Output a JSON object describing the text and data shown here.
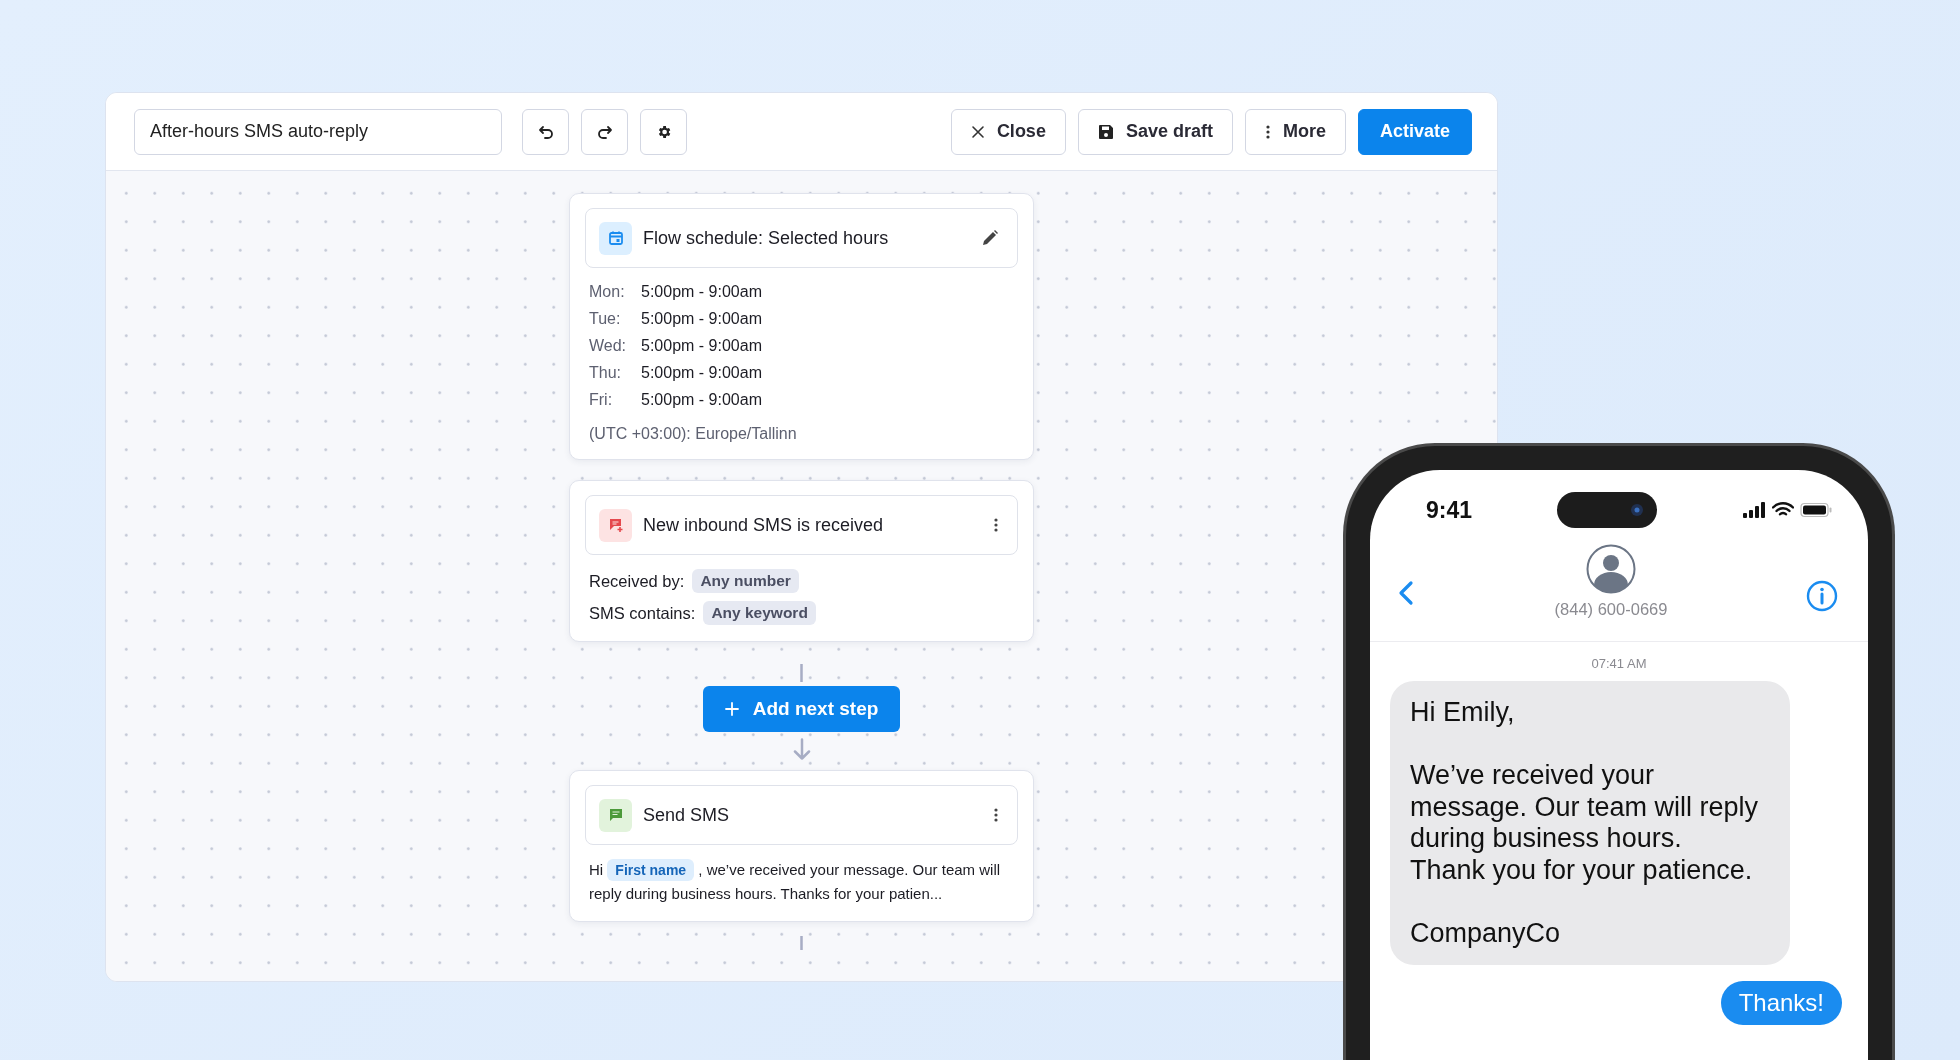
{
  "flow": {
    "title": "After-hours SMS auto-reply",
    "actions": [
      {
        "kind": "close",
        "label": "Close"
      },
      {
        "kind": "save",
        "label": "Save draft"
      },
      {
        "kind": "more",
        "label": "More"
      },
      {
        "kind": "primary",
        "label": "Activate"
      }
    ]
  },
  "steps": [
    {
      "kind": "schedule",
      "title": "Flow schedule: Selected hours",
      "schedule": [
        {
          "day": "Mon:",
          "hours": "5:00pm - 9:00am"
        },
        {
          "day": "Tue:",
          "hours": "5:00pm - 9:00am"
        },
        {
          "day": "Wed:",
          "hours": "5:00pm - 9:00am"
        },
        {
          "day": "Thu:",
          "hours": "5:00pm - 9:00am"
        },
        {
          "day": "Fri:",
          "hours": "5:00pm - 9:00am"
        }
      ],
      "timezone": "(UTC +03:00): Europe/Tallinn"
    },
    {
      "kind": "trigger",
      "title": "New inbound SMS is received",
      "conditions": [
        {
          "label": "Received by:",
          "value": "Any number"
        },
        {
          "label": "SMS contains:",
          "value": "Any keyword"
        }
      ]
    },
    {
      "kind": "action",
      "title": "Send SMS",
      "message_before": "Hi",
      "variable": "First name",
      "message_after": ", we’ve received your message. Our team will reply during business hours. Thanks for your patien..."
    }
  ],
  "add_step": {
    "label": "Add next step"
  },
  "phone": {
    "time": "9:41",
    "contact": "(844) 600-0669",
    "timestamp": "07:41 AM",
    "messages": [
      {
        "kind": "received",
        "text": "Hi Emily,\n\nWe’ve received your message. Our team will reply during business hours.\nThank you for your patience.\n\nCompanyCo"
      },
      {
        "kind": "sent",
        "text": "Thanks!"
      }
    ]
  }
}
